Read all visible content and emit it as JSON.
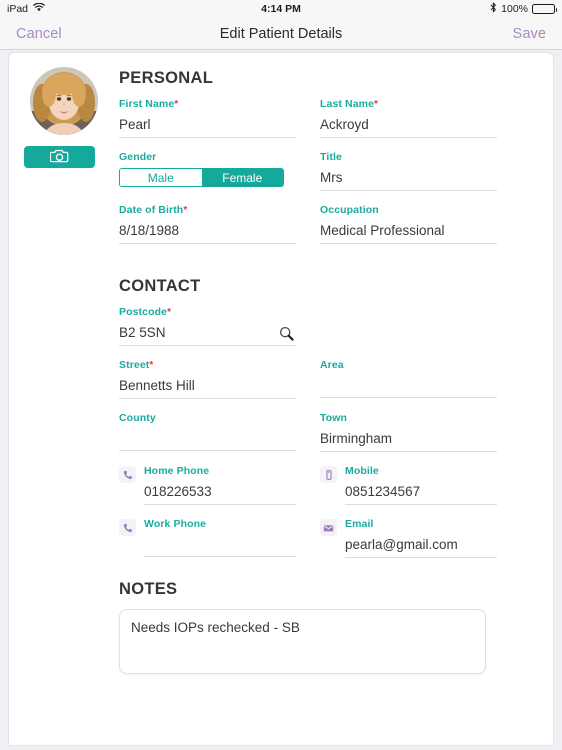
{
  "status_bar": {
    "device": "iPad",
    "wifi_icon": "wifi-icon",
    "time": "4:14 PM",
    "bluetooth_icon": "bluetooth-icon",
    "battery_percent": "100%",
    "battery_icon": "battery-full-icon"
  },
  "nav": {
    "cancel_label": "Cancel",
    "title": "Edit Patient Details",
    "save_label": "Save"
  },
  "avatar": {
    "camera_icon": "camera-icon"
  },
  "sections": {
    "personal_title": "PERSONAL",
    "contact_title": "CONTACT",
    "notes_title": "NOTES"
  },
  "personal": {
    "first_name": {
      "label": "First Name",
      "required": "*",
      "value": "Pearl"
    },
    "last_name": {
      "label": "Last Name",
      "required": "*",
      "value": "Ackroyd"
    },
    "gender": {
      "label": "Gender",
      "options": [
        "Male",
        "Female"
      ],
      "selected": "Female"
    },
    "title": {
      "label": "Title",
      "value": "Mrs"
    },
    "date_of_birth": {
      "label": "Date of Birth",
      "required": "*",
      "value": "8/18/1988"
    },
    "occupation": {
      "label": "Occupation",
      "value": "Medical Professional"
    }
  },
  "contact": {
    "postcode": {
      "label": "Postcode",
      "required": "*",
      "value": "B2 5SN",
      "search_icon": "search-icon"
    },
    "street": {
      "label": "Street",
      "required": "*",
      "value": "Bennetts Hill"
    },
    "area": {
      "label": "Area",
      "value": ""
    },
    "county": {
      "label": "County",
      "value": ""
    },
    "town": {
      "label": "Town",
      "value": "Birmingham"
    },
    "home_phone": {
      "label": "Home Phone",
      "value": "018226533",
      "icon": "phone-icon"
    },
    "mobile": {
      "label": "Mobile",
      "value": "0851234567",
      "icon": "mobile-icon"
    },
    "work_phone": {
      "label": "Work Phone",
      "value": "",
      "icon": "phone-icon"
    },
    "email": {
      "label": "Email",
      "value": "pearla@gmail.com",
      "icon": "envelope-icon"
    }
  },
  "notes": {
    "value": "Needs IOPs rechecked - SB"
  },
  "colors": {
    "accent_teal": "#14a99b",
    "label_teal": "#19ab9d",
    "required_red": "#e8324f",
    "nav_purple": "#a68bc0",
    "icon_purple": "#9b7cb8"
  }
}
